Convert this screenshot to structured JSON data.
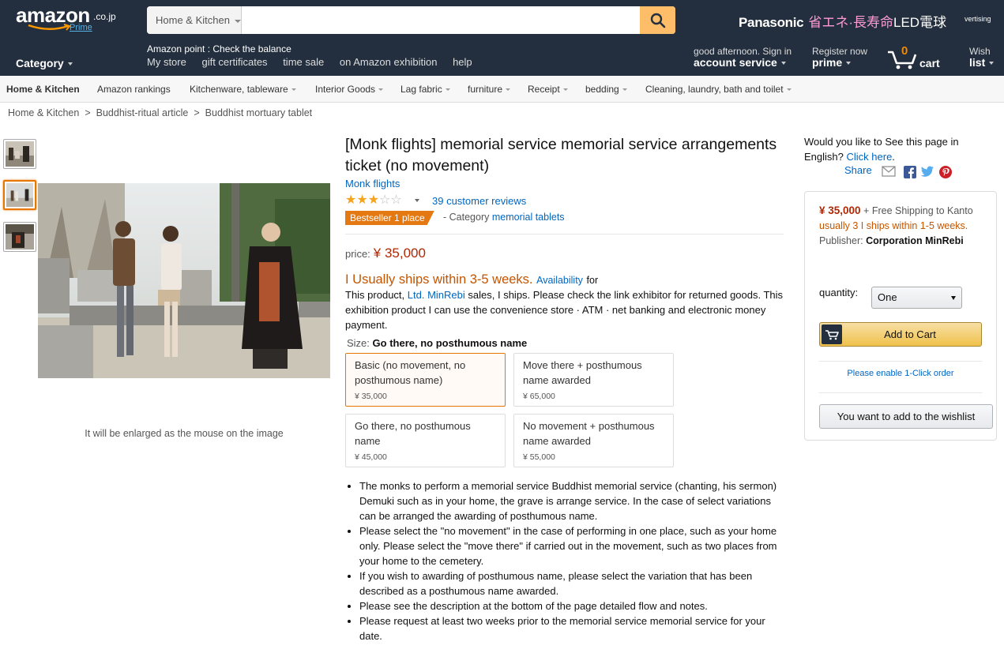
{
  "header": {
    "logo_text": "amazon",
    "logo_tld": ".co.jp",
    "logo_prime": "Prime",
    "search": {
      "department": "Home & Kitchen",
      "placeholder": "",
      "button_icon": "search-icon"
    },
    "promo": {
      "brand": "Panasonic",
      "tagline": "省エネ·長寿命",
      "product": "LED電球",
      "ad_label": "vertising"
    },
    "points_text": "Amazon point : Check the balance",
    "links": [
      "My store",
      "gift certificates",
      "time sale",
      "on Amazon exhibition",
      "help"
    ],
    "category_label": "Category",
    "account": {
      "line1": "good afternoon. Sign in",
      "line2": "account service"
    },
    "prime": {
      "line1": "Register now",
      "line2": "prime"
    },
    "cart": {
      "count": "0",
      "label": "cart"
    },
    "wishlist": {
      "line1": "Wish",
      "line2": "list"
    }
  },
  "subnav": {
    "home": "Home & Kitchen",
    "items": [
      "Amazon rankings",
      "Kitchenware, tableware",
      "Interior Goods",
      "Lag fabric",
      "furniture",
      "Receipt",
      "bedding",
      "Cleaning, laundry, bath and toilet"
    ]
  },
  "breadcrumb": [
    "Home & Kitchen",
    "Buddhist-ritual article",
    "Buddhist mortuary tablet"
  ],
  "product": {
    "title": "[Monk flights] memorial service memorial service arrangements ticket (no movement)",
    "brand": "Monk flights",
    "rating": 3,
    "rating_max": 5,
    "reviews": "39 customer reviews",
    "bestseller_badge": "Bestseller 1 place",
    "bestseller_prefix": "- Category",
    "bestseller_category": "memorial tablets",
    "price_label": "price:",
    "price": "¥ 35,000",
    "shipping": "I Usually ships within 3-5 weeks.",
    "availability_link": "Availability",
    "availability_for": "for",
    "seller_text_1": "This product,",
    "seller_link_1": "Ltd.",
    "seller_link_2": "MinRebi",
    "seller_text_2": "sales, I ships. Please check the link exhibitor for returned goods. This exhibition product I can use the convenience store · ATM · net banking and electronic money payment.",
    "size_label": "Size:",
    "size_value": "Go there, no posthumous name",
    "variants": [
      {
        "name": "Basic (no movement, no posthumous name)",
        "price": "¥ 35,000"
      },
      {
        "name": "Move there + posthumous name awarded",
        "price": "¥ 65,000"
      },
      {
        "name": "Go there, no posthumous name",
        "price": "¥ 45,000"
      },
      {
        "name": "No movement + posthumous name awarded",
        "price": "¥ 55,000"
      }
    ],
    "bullets": [
      "The monks to perform a memorial service Buddhist memorial service (chanting, his sermon) Demuki such as in your home, the grave is arrange service. In the case of select variations can be arranged the awarding of posthumous name.",
      "Please select the \"no movement\" in the case of performing in one place, such as your home only. Please select the \"move there\" if carried out in the movement, such as two places from your home to the cemetery.",
      "If you wish to awarding of posthumous name, please select the variation that has been described as a posthumous name awarded.",
      "Please see the description at the bottom of the page detailed flow and notes.",
      "Please request at least two weeks prior to the memorial service memorial service for your date."
    ],
    "enlarge_hint": "It will be enlarged as the mouse on the image"
  },
  "right": {
    "english_prompt": "Would you like to See this page in English?",
    "english_link": "Click here",
    "english_end": ".",
    "share_label": "Share",
    "buybox": {
      "price": "¥ 35,000",
      "shipping": "+ Free Shipping to Kanto",
      "ships": "usually 3 I ships within 1-5 weeks.",
      "publisher_label": "Publisher:",
      "publisher": "Corporation MinRebi",
      "quantity_label": "quantity:",
      "quantity_value": "One",
      "add_to_cart": "Add to Cart",
      "one_click": "Please enable 1-Click order",
      "wishlist_button": "You want to add to the wishlist"
    }
  },
  "colors": {
    "header_bg": "#232f3e",
    "link": "#0066c0",
    "price": "#b12704",
    "ships": "#c45500",
    "badge": "#e47911",
    "search_button": "#febd69"
  }
}
